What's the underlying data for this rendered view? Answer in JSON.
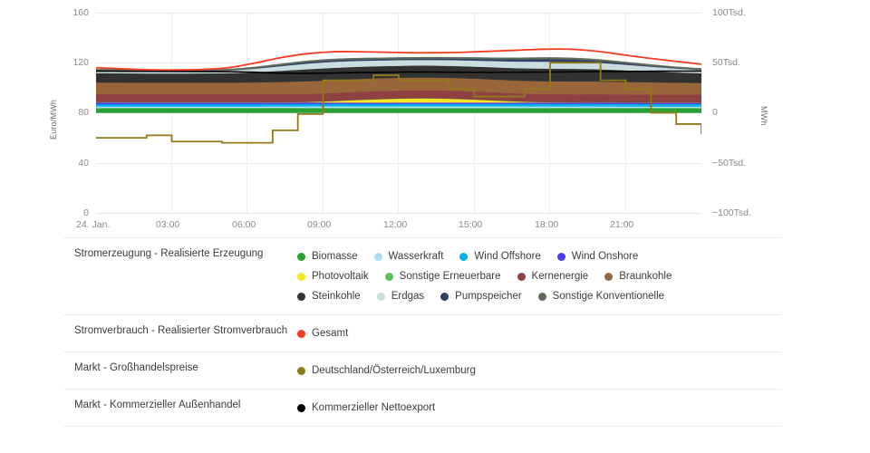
{
  "axes": {
    "left_title": "Euro/MWh",
    "right_title": "MWh",
    "left_ticks": [
      "160",
      "120",
      "80",
      "40",
      "0"
    ],
    "right_ticks": [
      "100Tsd.",
      "50Tsd.",
      "0",
      "−50Tsd.",
      "−100Tsd."
    ],
    "x_ticks": [
      "24. Jan.",
      "03:00",
      "06:00",
      "09:00",
      "12:00",
      "15:00",
      "18:00",
      "21:00"
    ]
  },
  "legend": {
    "rows": [
      {
        "category": "Stromerzeugung - Realisierte Erzeugung",
        "items": [
          {
            "label": "Biomasse",
            "color": "#2aa033",
            "icon": "legend-dot"
          },
          {
            "label": "Wasserkraft",
            "color": "#aadff0",
            "icon": "legend-dot"
          },
          {
            "label": "Wind Offshore",
            "color": "#00b0e8",
            "icon": "legend-dot"
          },
          {
            "label": "Wind Onshore",
            "color": "#4a3cf0",
            "icon": "legend-dot"
          },
          {
            "label": "Photovoltaik",
            "color": "#f7e722",
            "icon": "legend-dot"
          },
          {
            "label": "Sonstige Erneuerbare",
            "color": "#5cbe5c",
            "icon": "legend-dot"
          },
          {
            "label": "Kernenergie",
            "color": "#8e4140",
            "icon": "legend-dot"
          },
          {
            "label": "Braunkohle",
            "color": "#99663b",
            "icon": "legend-dot"
          },
          {
            "label": "Steinkohle",
            "color": "#323232",
            "icon": "legend-dot"
          },
          {
            "label": "Erdgas",
            "color": "#cbdedf",
            "icon": "legend-dot"
          },
          {
            "label": "Pumpspeicher",
            "color": "#2d3f63",
            "icon": "legend-dot"
          },
          {
            "label": "Sonstige Konventionelle",
            "color": "#5e6b5a",
            "icon": "legend-dot"
          }
        ]
      },
      {
        "category": "Stromverbrauch - Realisierter Stromverbrauch",
        "items": [
          {
            "label": "Gesamt",
            "color": "#f63b1f",
            "icon": "legend-dot"
          }
        ]
      },
      {
        "category": "Markt - Großhandelspreise",
        "items": [
          {
            "label": "Deutschland/Österreich/Luxemburg",
            "color": "#91791a",
            "icon": "legend-dot"
          }
        ]
      },
      {
        "category": "Markt - Kommerzieller Außenhandel",
        "items": [
          {
            "label": "Kommerzieller Nettoexport",
            "color": "#000000",
            "icon": "legend-dot"
          }
        ]
      }
    ]
  },
  "chart_data": {
    "type": "area",
    "title": "",
    "xlabel": "",
    "ylabel": "Euro/MWh",
    "y2label": "MWh",
    "ylim": [
      0,
      160
    ],
    "y2lim": [
      -100000,
      100000
    ],
    "grid": true,
    "legend_position": "bottom",
    "x": [
      "00:00",
      "01:00",
      "02:00",
      "03:00",
      "04:00",
      "05:00",
      "06:00",
      "07:00",
      "08:00",
      "09:00",
      "10:00",
      "11:00",
      "12:00",
      "13:00",
      "14:00",
      "15:00",
      "16:00",
      "17:00",
      "18:00",
      "19:00",
      "20:00",
      "21:00",
      "22:00",
      "23:00"
    ],
    "x_tick_labels": [
      "24. Jan.",
      "03:00",
      "06:00",
      "09:00",
      "12:00",
      "15:00",
      "18:00",
      "21:00"
    ],
    "note_units": "Stacked generation series read on the right axis (MWh); price and export lines read on the left axis (Euro/MWh).",
    "stacked_series_order": [
      "Biomasse",
      "Wasserkraft",
      "Wind Offshore",
      "Wind Onshore",
      "Photovoltaik",
      "Sonstige Erneuerbare",
      "Kernenergie",
      "Braunkohle",
      "Steinkohle",
      "Erdgas",
      "Pumpspeicher",
      "Sonstige Konventionelle"
    ],
    "series": [
      {
        "name": "Biomasse",
        "color": "#2aa033",
        "stacked": true,
        "values": [
          4800,
          4800,
          4800,
          4800,
          4800,
          4800,
          4800,
          4800,
          4800,
          4800,
          4800,
          4800,
          4800,
          4800,
          4800,
          4800,
          4800,
          4800,
          4800,
          4800,
          4800,
          4800,
          4800,
          4800
        ]
      },
      {
        "name": "Wasserkraft",
        "color": "#aadff0",
        "stacked": true,
        "values": [
          1500,
          1500,
          1500,
          1500,
          1500,
          1500,
          1500,
          1600,
          1700,
          1700,
          1700,
          1700,
          1700,
          1700,
          1700,
          1700,
          1700,
          1700,
          1700,
          1700,
          1600,
          1500,
          1500,
          1500
        ]
      },
      {
        "name": "Wind Offshore",
        "color": "#00b0e8",
        "stacked": true,
        "values": [
          2300,
          2300,
          2300,
          2300,
          2300,
          2300,
          2300,
          2300,
          2300,
          2300,
          2300,
          2300,
          2400,
          2400,
          2400,
          2400,
          2400,
          2400,
          2400,
          2400,
          2400,
          2400,
          2400,
          2400
        ]
      },
      {
        "name": "Wind Onshore",
        "color": "#4a3cf0",
        "stacked": true,
        "values": [
          1900,
          1900,
          1800,
          1800,
          1800,
          1800,
          1800,
          1700,
          1600,
          1500,
          1400,
          1400,
          1400,
          1400,
          1400,
          1400,
          1400,
          1400,
          1400,
          1400,
          1400,
          1400,
          1400,
          1400
        ]
      },
      {
        "name": "Photovoltaik",
        "color": "#f7e722",
        "stacked": true,
        "values": [
          0,
          0,
          0,
          0,
          0,
          0,
          0,
          0,
          300,
          1300,
          2600,
          3500,
          4000,
          3900,
          3200,
          2100,
          900,
          200,
          0,
          0,
          0,
          0,
          0,
          0
        ]
      },
      {
        "name": "Sonstige Erneuerbare",
        "color": "#5cbe5c",
        "stacked": true,
        "values": [
          200,
          200,
          200,
          200,
          200,
          200,
          200,
          200,
          200,
          200,
          200,
          200,
          200,
          200,
          200,
          200,
          200,
          200,
          200,
          200,
          200,
          200,
          200,
          200
        ]
      },
      {
        "name": "Kernenergie",
        "color": "#8e4140",
        "stacked": true,
        "values": [
          8000,
          8000,
          8000,
          8000,
          8000,
          8000,
          8000,
          8000,
          8000,
          8000,
          8000,
          8000,
          8000,
          8000,
          8000,
          8000,
          8000,
          8000,
          8000,
          8000,
          8000,
          8000,
          8000,
          8000
        ]
      },
      {
        "name": "Braunkohle",
        "color": "#99663b",
        "stacked": true,
        "values": [
          11500,
          11500,
          11500,
          11500,
          11500,
          11500,
          11800,
          12200,
          12600,
          12800,
          12800,
          12800,
          12800,
          12800,
          12800,
          12800,
          12800,
          12900,
          12900,
          12800,
          12500,
          12200,
          11800,
          11500
        ]
      },
      {
        "name": "Steinkohle",
        "color": "#323232",
        "stacked": true,
        "values": [
          9500,
          9300,
          9200,
          9200,
          9300,
          9500,
          10200,
          11200,
          12000,
          12300,
          12200,
          12000,
          11900,
          11900,
          12000,
          12200,
          12400,
          12600,
          12600,
          12300,
          11700,
          11000,
          10300,
          9800
        ]
      },
      {
        "name": "Erdgas",
        "color": "#cbdedf",
        "stacked": true,
        "values": [
          2500,
          2400,
          2300,
          2300,
          2400,
          2600,
          3400,
          4600,
          5600,
          6000,
          5900,
          5700,
          5600,
          5700,
          5900,
          6200,
          6600,
          6900,
          6900,
          6500,
          5700,
          4800,
          3900,
          3200
        ]
      },
      {
        "name": "Pumpspeicher",
        "color": "#2d3f63",
        "stacked": true,
        "values": [
          300,
          300,
          300,
          300,
          300,
          300,
          500,
          900,
          1300,
          1400,
          1300,
          1200,
          1200,
          1300,
          1500,
          1800,
          2200,
          2500,
          2400,
          1900,
          1300,
          800,
          500,
          400
        ]
      },
      {
        "name": "Sonstige Konventionelle",
        "color": "#5e6b5a",
        "stacked": true,
        "values": [
          1200,
          1200,
          1200,
          1200,
          1200,
          1200,
          1300,
          1400,
          1500,
          1500,
          1500,
          1500,
          1500,
          1500,
          1500,
          1500,
          1600,
          1700,
          1700,
          1600,
          1500,
          1400,
          1300,
          1200
        ]
      },
      {
        "name": "Gesamt",
        "color": "#f63b1f",
        "stacked": false,
        "axis": "right",
        "unit": "MWh",
        "values": [
          50500,
          49500,
          48500,
          48300,
          48800,
          50500,
          55000,
          60500,
          64500,
          66500,
          66500,
          66000,
          65500,
          65500,
          66000,
          67000,
          68000,
          69000,
          69000,
          67000,
          63500,
          60000,
          57000,
          54000
        ]
      },
      {
        "name": "Deutschland/Österreich/Luxemburg",
        "color": "#91791a",
        "stacked": false,
        "axis": "left",
        "unit": "Euro/MWh",
        "step": true,
        "values": [
          60,
          60,
          62,
          57,
          57,
          56,
          56,
          66,
          79,
          106,
          106,
          110,
          106,
          106,
          99,
          93,
          93,
          99,
          120,
          120,
          106,
          99,
          80,
          71,
          63
        ]
      },
      {
        "name": "Kommerzieller Nettoexport",
        "color": "#000000",
        "stacked": false,
        "axis": "right",
        "unit": "MWh",
        "values": [
          1600,
          1500,
          1400,
          1300,
          1200,
          1100,
          600,
          -400,
          -600,
          -300,
          200,
          600,
          800,
          700,
          500,
          400,
          500,
          700,
          900,
          1100,
          1300,
          1500,
          1600,
          1700
        ]
      }
    ]
  }
}
